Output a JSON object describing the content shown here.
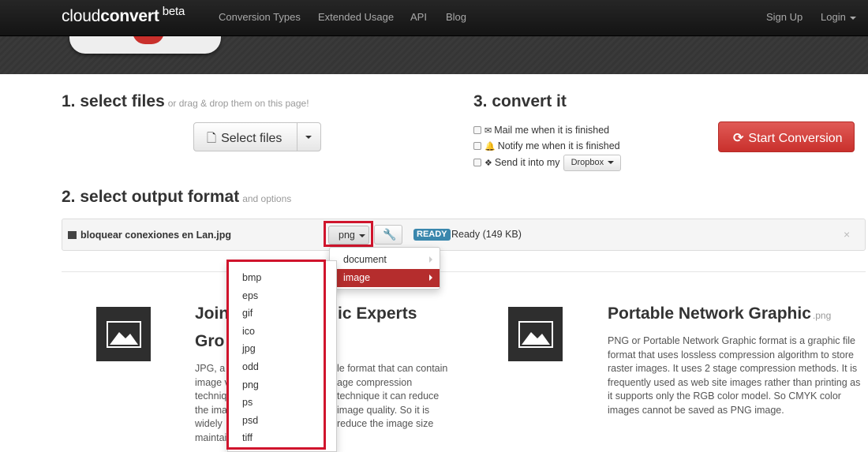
{
  "navbar": {
    "brand_light": "cloud",
    "brand_bold": "convert",
    "brand_tag": "beta",
    "links": [
      "Conversion Types",
      "Extended Usage",
      "API",
      "Blog"
    ],
    "sign_up": "Sign Up",
    "login": "Login"
  },
  "step1": {
    "title": "1. select files",
    "subtitle": "or drag & drop them on this page!",
    "select_files_label": "Select files"
  },
  "step3": {
    "title": "3. convert it",
    "options": {
      "mail": "Mail me when it is finished",
      "notify": "Notify me when it is finished",
      "send": "Send it into my",
      "dropbox": "Dropbox"
    },
    "start_label": "Start Conversion",
    "start_color": "#c9302c"
  },
  "step2": {
    "title": "2. select output format",
    "subtitle": "and options"
  },
  "file": {
    "name": "bloquear conexiones en Lan.jpg",
    "format": "png",
    "status_badge": "READY",
    "status_text": "Ready (149 KB)",
    "close": "×",
    "badge_color": "#3a87ad"
  },
  "menu": {
    "categories": [
      "document",
      "image"
    ],
    "active_category": "image",
    "image_formats": [
      "bmp",
      "eps",
      "gif",
      "ico",
      "jpg",
      "odd",
      "png",
      "ps",
      "psd",
      "tiff"
    ],
    "highlight_color": "#d0142c"
  },
  "info_left": {
    "title_a": "Join",
    "title_b": "ic Experts",
    "title_c": "Gro",
    "line1_a": "JPG, a",
    "line1_b": "le format that can contain",
    "line2_a": "image v",
    "line2_b": "age compression",
    "line3_a": "techniq",
    "line3_b": "technique it can reduce",
    "line4_a": "the ima",
    "line4_b": "image quality. So it is",
    "line5_a": "widely",
    "line5_b": "reduce the image size",
    "line6_a": "maintai"
  },
  "info_right": {
    "title": "Portable Network Graphic",
    "ext": ".png",
    "text": "PNG or Portable Network Graphic format is a graphic file format that uses lossless compression algorithm to store raster images. It uses 2 stage compression methods. It is frequently used as web site images rather than printing as it supports only the RGB color model. So CMYK color images cannot be saved as PNG image."
  }
}
